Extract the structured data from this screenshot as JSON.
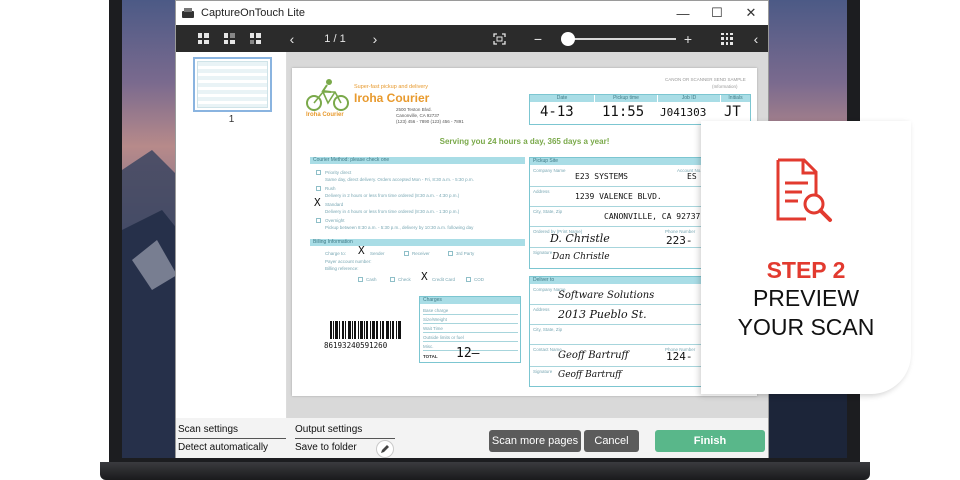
{
  "window": {
    "title": "CaptureOnTouch Lite",
    "minimize": "—",
    "maximize": "☐",
    "close": "✕"
  },
  "toolbar": {
    "page_indicator": "1 / 1",
    "prev": "‹",
    "next": "›",
    "zoom_out": "−",
    "zoom_in": "+",
    "collapse": "‹"
  },
  "thumbnail": {
    "page_number": "1"
  },
  "document": {
    "company_tagline": "Super-fast pickup and delivery",
    "company_name": "Iroha Courier",
    "logo_text": "Iroha Courier",
    "address_lines": [
      "2500 Teston Blvd.",
      "Canonville, CA 92737",
      "(123) 456 - 7890  (123) 456 - 7891"
    ],
    "corner_note_1": "CANON OR SCANNER SEND SAMPLE",
    "corner_note_2": "(Information)",
    "table_headers": [
      "Date",
      "Pickup time",
      "Job ID",
      "Initials"
    ],
    "table_values": [
      "4-13",
      "11:55",
      "J041303",
      "JT"
    ],
    "slogan": "Serving you 24 hours a day, 365 days a year!",
    "courier_header": "Courier Method: please check one",
    "courier_options": [
      {
        "label": "Priority direct",
        "desc": "Same day, direct delivery. Orders accepted Mon - Fri, 8:30 a.m. - 5:30 p.m."
      },
      {
        "label": "Rush",
        "desc": "Delivery in 2 hours or less from time ordered (8:30 a.m. - 4:30 p.m.)"
      },
      {
        "label": "Standard",
        "desc": "Delivery in 4 hours or less from time ordered (8:30 a.m. - 1:30 p.m.)"
      },
      {
        "label": "Overnight",
        "desc": "Pickup between 8:30 a.m. - 5:30 p.m., delivery by 10:30 a.m. following day"
      }
    ],
    "billing_header": "Billing Information",
    "billing_charge_to": "Charge to:",
    "billing_options": [
      "Sender",
      "Receiver",
      "3rd Party"
    ],
    "billing_payer": "Payer account number:",
    "billing_category": "Billing reference:",
    "payment_options": [
      "Cash",
      "Check",
      "Credit Card",
      "COD"
    ],
    "mark": "X",
    "charges_header": "Charges",
    "charges_rows": [
      "Base charge",
      "Size/Weight",
      "Wait Time",
      "Outside limits or fuel",
      "Misc.",
      "TOTAL"
    ],
    "charges_total": "12—",
    "barcode_number": "86193240591260",
    "pickup_header": "Pickup Site",
    "pickup_labels": [
      "Company Name",
      "Account No.",
      "Address",
      "City, State, Zip",
      "Ordered by (Print Name)",
      "Phone Number",
      "Signature"
    ],
    "pickup_company": "E23 SYSTEMS",
    "pickup_account": "ES",
    "pickup_address": "1239 VALENCE BLVD.",
    "pickup_city": "CANONVILLE, CA 92737",
    "pickup_name": "D. Christle",
    "pickup_phone": "223-",
    "pickup_signature": "Dan Christle",
    "deliver_header": "Deliver to",
    "deliver_labels": [
      "Company Name",
      "Address",
      "City, State, Zip",
      "Contact Name",
      "Phone Number",
      "Signature"
    ],
    "deliver_company": "Software Solutions",
    "deliver_address": "2013 Pueblo St.",
    "deliver_contact": "Geoff Bartruff",
    "deliver_phone": "124-",
    "deliver_signature": "Geoff Bartruff"
  },
  "bottom": {
    "scan_settings_label": "Scan settings",
    "scan_settings_value": "Detect automatically",
    "output_settings_label": "Output settings",
    "output_settings_value": "Save to folder",
    "scan_more_button": "Scan more pages",
    "cancel_button": "Cancel",
    "finish_button": "Finish"
  },
  "overlay": {
    "step_number": "STEP 2",
    "line1": "PREVIEW",
    "line2": "YOUR SCAN",
    "icon": "document-search-icon",
    "accent": "#e23a2f"
  },
  "colors": {
    "toolbar": "#2b2b2b",
    "finish": "#59b78a",
    "form_accent": "#a9dde6",
    "logo": "#e89a2e"
  }
}
